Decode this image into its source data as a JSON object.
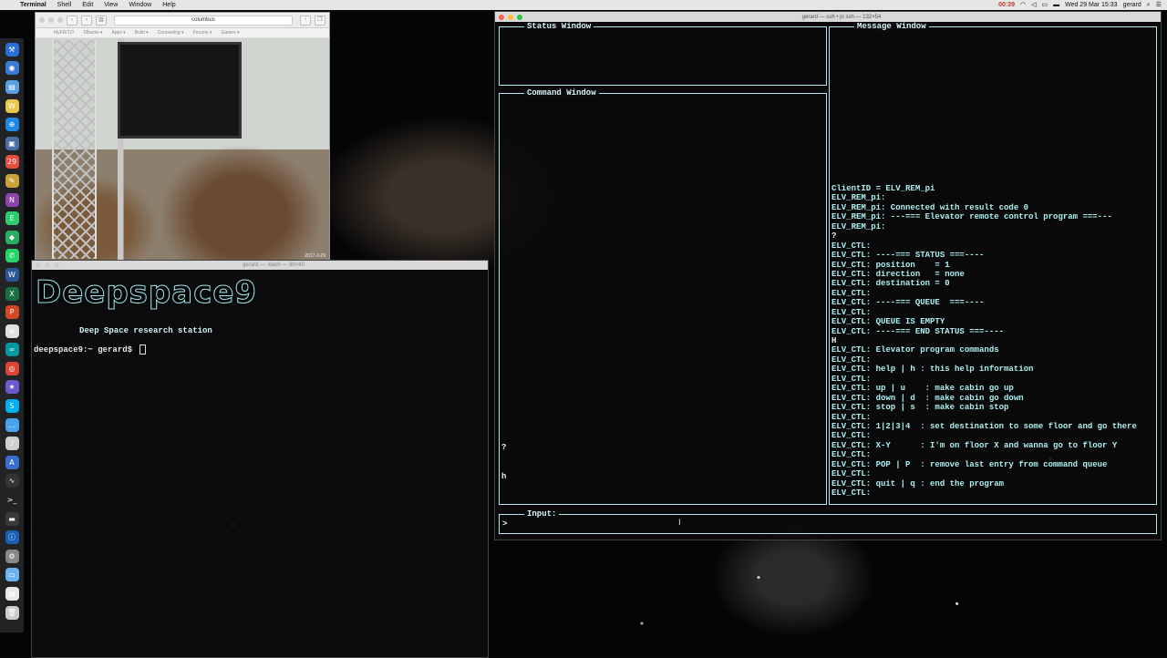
{
  "menubar": {
    "app_name": "Terminal",
    "items": [
      "Shell",
      "Edit",
      "View",
      "Window",
      "Help"
    ],
    "battery_badge": "00:39",
    "datetime": "Wed 29 Mar  15:33",
    "user": "gerard"
  },
  "browser": {
    "url": "columbus",
    "bookmarks": [
      "MyFRITZ!",
      "SBanks ▾",
      "Apps ▾",
      "Build ▾",
      "Counseling ▾",
      "Forums ▾",
      "Games ▾"
    ],
    "timestamp": "2017-3-29"
  },
  "left_terminal": {
    "title": "gerard — -bash — 80×40",
    "banner": "Deepspace9",
    "station": "Deep Space research station",
    "prompt": "deepspace9:~ gerard$ "
  },
  "right_terminal": {
    "title": "gerard — ssh • pi ssh — 132×54",
    "status_window_title": "Status Window",
    "command_window_title": "Command Window",
    "message_window_title": "Message Window",
    "input_title": "Input:",
    "input_prompt": ">",
    "command_lines": [
      "?",
      "h"
    ],
    "message_lines": [
      {
        "text": "ClientID = ELV_REM_pi",
        "color": "cyan"
      },
      {
        "text": "ELV_REM_pi:",
        "color": "cyan"
      },
      {
        "text": "ELV_REM_pi: Connected with result code 0",
        "color": "cyan"
      },
      {
        "text": "ELV_REM_pi: ---=== Elevator remote control program ===---",
        "color": "cyan"
      },
      {
        "text": "ELV_REM_pi:",
        "color": "cyan"
      },
      {
        "text": "?",
        "color": "white"
      },
      {
        "text": "ELV_CTL:",
        "color": "cyan"
      },
      {
        "text": "ELV_CTL: ----=== STATUS ===----",
        "color": "cyan"
      },
      {
        "text": "ELV_CTL: position    = 1",
        "color": "cyan"
      },
      {
        "text": "ELV_CTL: direction   = none",
        "color": "cyan"
      },
      {
        "text": "ELV_CTL: destination = 0",
        "color": "cyan"
      },
      {
        "text": "ELV_CTL:",
        "color": "cyan"
      },
      {
        "text": "ELV_CTL: ----=== QUEUE  ===----",
        "color": "cyan"
      },
      {
        "text": "ELV_CTL:",
        "color": "cyan"
      },
      {
        "text": "ELV_CTL: QUEUE IS EMPTY",
        "color": "cyan"
      },
      {
        "text": "ELV_CTL: ----=== END STATUS ===----",
        "color": "cyan"
      },
      {
        "text": "H",
        "color": "white"
      },
      {
        "text": "ELV_CTL: Elevator program commands",
        "color": "cyan"
      },
      {
        "text": "ELV_CTL:",
        "color": "cyan"
      },
      {
        "text": "ELV_CTL: help | h : this help information",
        "color": "cyan"
      },
      {
        "text": "ELV_CTL:",
        "color": "cyan"
      },
      {
        "text": "ELV_CTL: up | u    : make cabin go up",
        "color": "cyan"
      },
      {
        "text": "ELV_CTL: down | d  : make cabin go down",
        "color": "cyan"
      },
      {
        "text": "ELV_CTL: stop | s  : make cabin stop",
        "color": "cyan"
      },
      {
        "text": "ELV_CTL:",
        "color": "cyan"
      },
      {
        "text": "ELV_CTL: 1|2|3|4  : set destination to some floor and go there",
        "color": "cyan"
      },
      {
        "text": "ELV_CTL:",
        "color": "cyan"
      },
      {
        "text": "ELV_CTL: X-Y      : I'm on floor X and wanna go to floor Y",
        "color": "cyan"
      },
      {
        "text": "ELV_CTL:",
        "color": "cyan"
      },
      {
        "text": "ELV_CTL: POP | P  : remove last entry from command queue",
        "color": "cyan"
      },
      {
        "text": "ELV_CTL:",
        "color": "cyan"
      },
      {
        "text": "ELV_CTL: quit | q : end the program",
        "color": "cyan"
      },
      {
        "text": "ELV_CTL:",
        "color": "cyan"
      }
    ]
  },
  "dock_icons": [
    {
      "name": "xcode-icon",
      "color": "#2a6fd6",
      "glyph": "⚒"
    },
    {
      "name": "safari-alt-icon",
      "color": "#3a7bd5",
      "glyph": "◉"
    },
    {
      "name": "preview-icon",
      "color": "#5aa0e0",
      "glyph": "▤"
    },
    {
      "name": "itunes-icon",
      "color": "#e8c84a",
      "glyph": "W"
    },
    {
      "name": "safari-icon",
      "color": "#1e88e5",
      "glyph": "⊕"
    },
    {
      "name": "photos-icon",
      "color": "#4a6fa5",
      "glyph": "▣"
    },
    {
      "name": "calendar-icon",
      "color": "#e74c3c",
      "glyph": "29"
    },
    {
      "name": "notes-icon",
      "color": "#c9a23a",
      "glyph": "✎"
    },
    {
      "name": "onenote-icon",
      "color": "#8e44ad",
      "glyph": "N"
    },
    {
      "name": "evernote-icon",
      "color": "#2ecc71",
      "glyph": "E"
    },
    {
      "name": "maps-icon",
      "color": "#27ae60",
      "glyph": "◆"
    },
    {
      "name": "whatsapp-icon",
      "color": "#25d366",
      "glyph": "✆"
    },
    {
      "name": "word-icon",
      "color": "#2b5797",
      "glyph": "W"
    },
    {
      "name": "excel-icon",
      "color": "#1d7044",
      "glyph": "X"
    },
    {
      "name": "powerpoint-icon",
      "color": "#d24726",
      "glyph": "P"
    },
    {
      "name": "chrome-devtools-icon",
      "color": "#e0e0e0",
      "glyph": "⊗"
    },
    {
      "name": "arduino-icon",
      "color": "#00979d",
      "glyph": "∞"
    },
    {
      "name": "chrome-icon",
      "color": "#db4437",
      "glyph": "◎"
    },
    {
      "name": "imovie-icon",
      "color": "#6a5acd",
      "glyph": "★"
    },
    {
      "name": "skype-icon",
      "color": "#00aff0",
      "glyph": "S"
    },
    {
      "name": "messages-icon",
      "color": "#4aa3f0",
      "glyph": "…"
    },
    {
      "name": "music-icon",
      "color": "#cfcfcf",
      "glyph": "♪"
    },
    {
      "name": "app-store-icon",
      "color": "#3a6fd0",
      "glyph": "A"
    },
    {
      "name": "activity-monitor-icon",
      "color": "#333333",
      "glyph": "∿"
    },
    {
      "name": "terminal-icon",
      "color": "#222222",
      "glyph": ">_"
    },
    {
      "name": "console-icon",
      "color": "#3a3a3a",
      "glyph": "▬"
    },
    {
      "name": "1password-icon",
      "color": "#1a5fb4",
      "glyph": "ⓘ"
    },
    {
      "name": "system-preferences-icon",
      "color": "#888888",
      "glyph": "⚙"
    },
    {
      "name": "downloads-folder-icon",
      "color": "#6db3f2",
      "glyph": "▭"
    },
    {
      "name": "documents-icon",
      "color": "#e8e8e8",
      "glyph": "▤"
    },
    {
      "name": "trash-icon",
      "color": "#cccccc",
      "glyph": "🗑"
    }
  ]
}
